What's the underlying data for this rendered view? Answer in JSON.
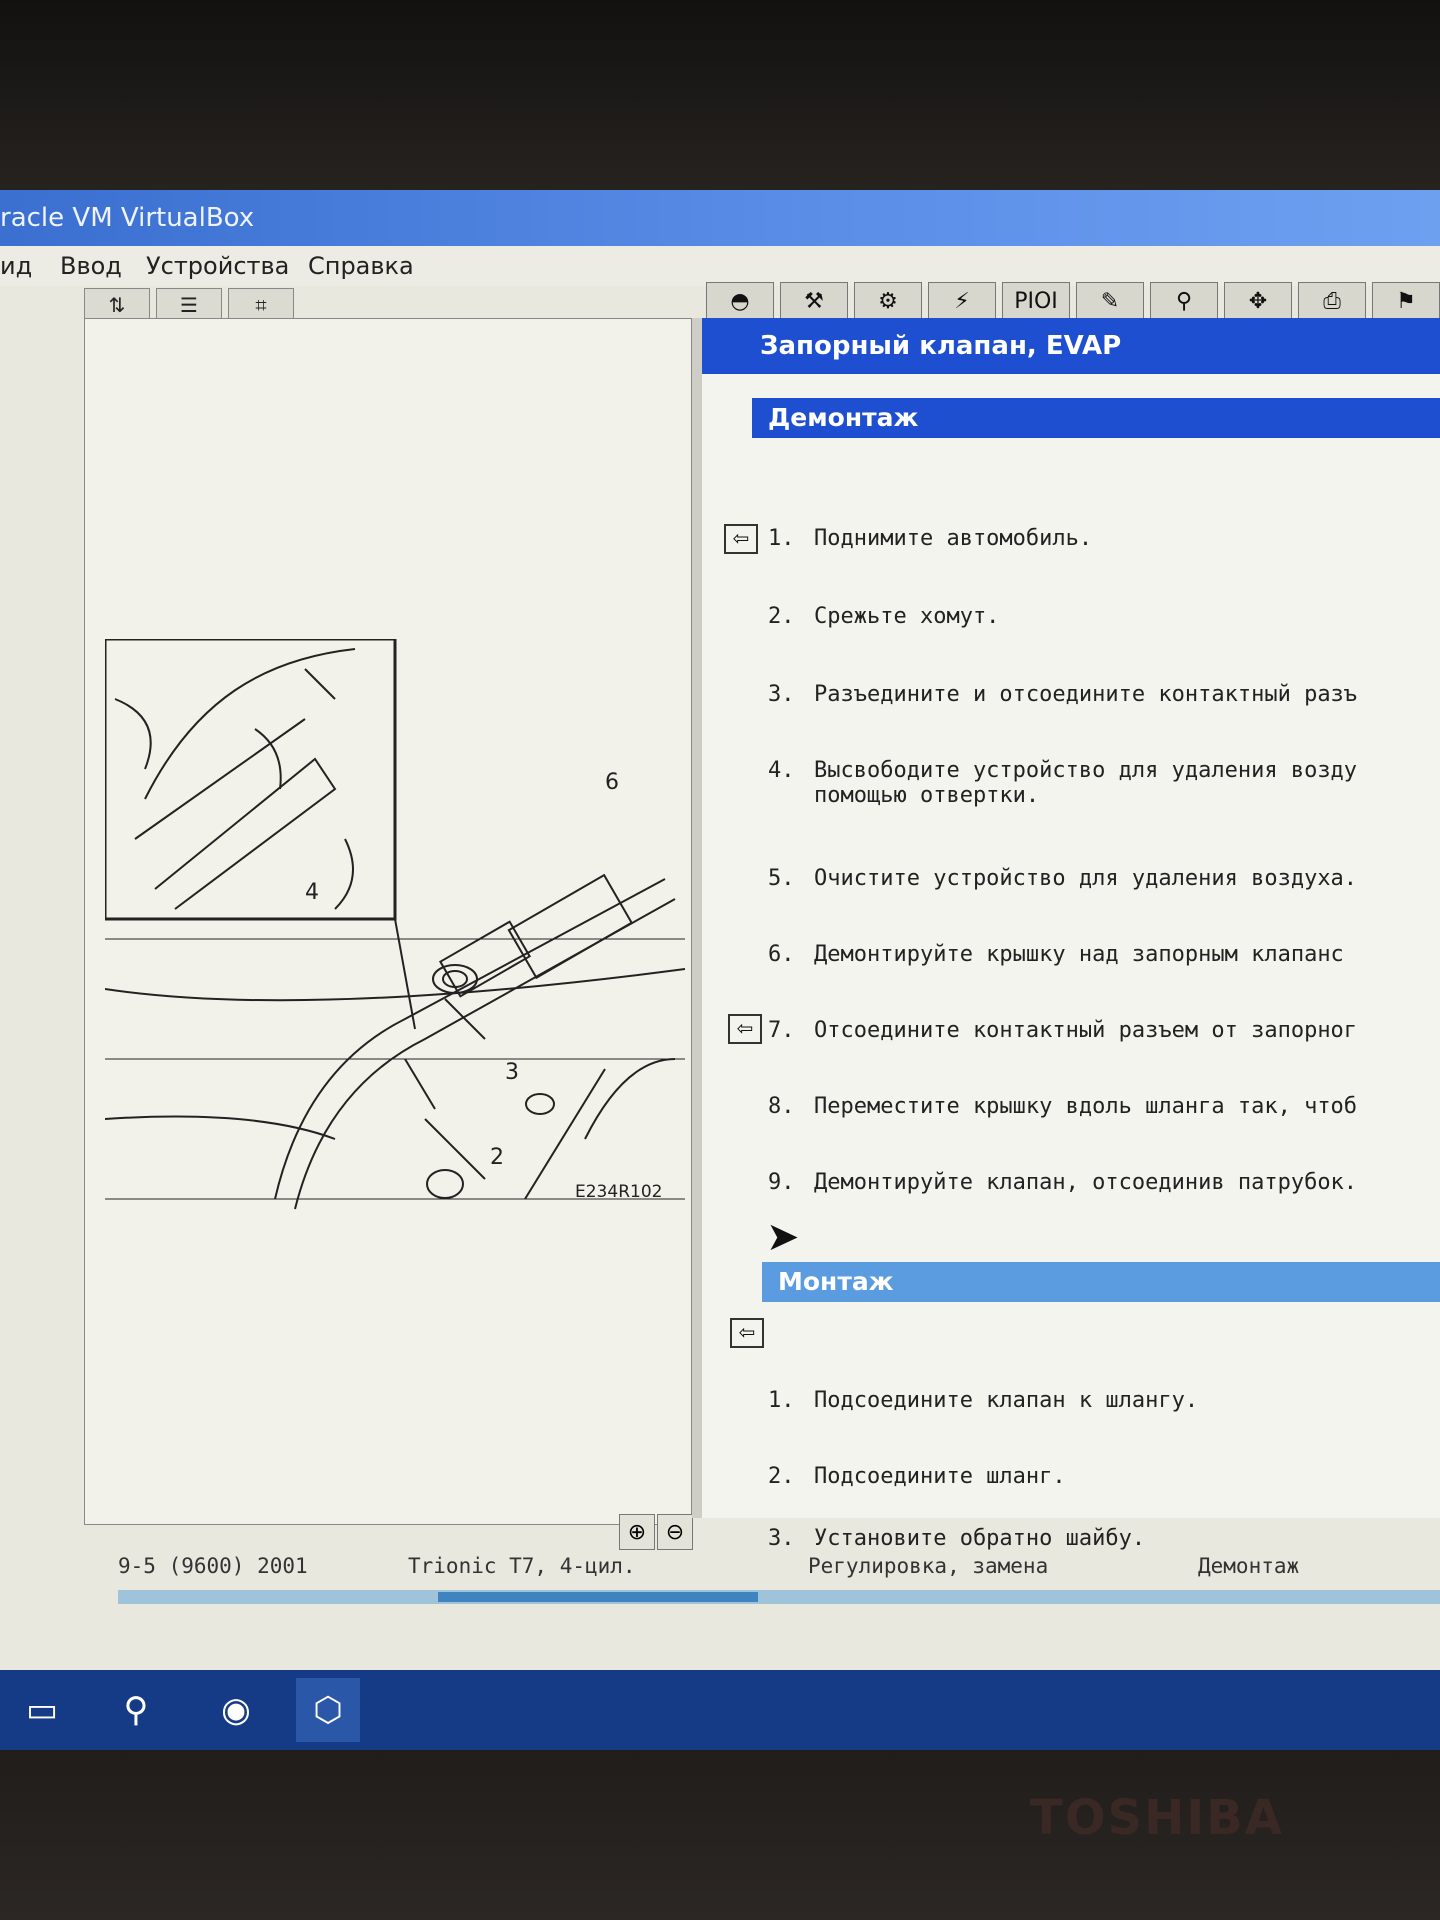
{
  "window": {
    "title": "racle VM VirtualBox"
  },
  "menu": {
    "items": [
      "ид",
      "Ввод",
      "Устройства",
      "Справка"
    ]
  },
  "right_toolbar": {
    "pioi_label": "PIOI"
  },
  "document": {
    "title": "Запорный клапан, EVAP",
    "sections": [
      {
        "heading": "Демонтаж",
        "steps": [
          {
            "num": "1.",
            "text": "Поднимите автомобиль."
          },
          {
            "num": "2.",
            "text": "Срежьте хомут."
          },
          {
            "num": "3.",
            "text": "Разъедините и отсоедините контактный разъ"
          },
          {
            "num": "4.",
            "text": "Высвободите устройство для удаления возду",
            "text2": "помощью отвертки."
          },
          {
            "num": "5.",
            "text": "Очистите устройство для удаления воздуха."
          },
          {
            "num": "6.",
            "text": "Демонтируйте крышку над запорным клапанс"
          },
          {
            "num": "7.",
            "text": "Отсоедините контактный разъем от запорног"
          },
          {
            "num": "8.",
            "text": "Переместите крышку вдоль шланга так, чтоб"
          },
          {
            "num": "9.",
            "text": "Демонтируйте клапан, отсоединив патрубок."
          }
        ]
      },
      {
        "heading": "Монтаж",
        "steps": [
          {
            "num": "1.",
            "text": "Подсоедините клапан к шлангу."
          },
          {
            "num": "2.",
            "text": "Подсоедините шланг."
          },
          {
            "num": "3.",
            "text": "Установите обратно шайбу."
          }
        ]
      }
    ]
  },
  "illustration": {
    "code": "E234R102",
    "callouts": [
      "6",
      "4",
      "3",
      "2"
    ]
  },
  "statusbar": {
    "model": "9-5 (9600) 2001",
    "engine": "Trionic T7, 4-цил.",
    "category": "Регулировка, замена",
    "section": "Демонтаж"
  },
  "brand": "TOSHIBA",
  "colors": {
    "header_blue": "#1e4fd0",
    "mount_blue": "#5b9be0",
    "taskbar": "#163b86"
  }
}
